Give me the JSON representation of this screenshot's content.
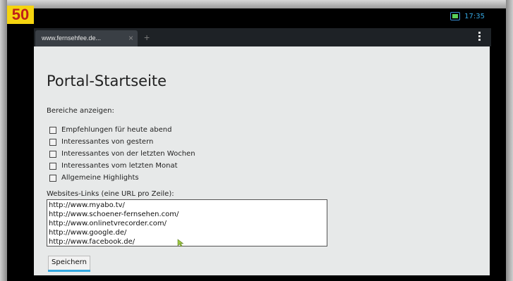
{
  "badge": {
    "number": "50"
  },
  "status_bar": {
    "time": "17:35",
    "icons": [
      "signal-icon"
    ]
  },
  "browser": {
    "tab_title": "www.fernsehfee.de...",
    "tab_close_glyph": "×",
    "new_tab_glyph": "+",
    "menu_icon": "overflow-menu-icon"
  },
  "page": {
    "title": "Portal-Startseite",
    "section_label": "Bereiche anzeigen:",
    "checkboxes": [
      {
        "label": "Empfehlungen für heute abend",
        "checked": false
      },
      {
        "label": "Interessantes von gestern",
        "checked": false
      },
      {
        "label": "Interessantes von der letzten Wochen",
        "checked": false
      },
      {
        "label": "Interessantes vom letzten Monat",
        "checked": false
      },
      {
        "label": "Allgemeine Highlights",
        "checked": false
      }
    ],
    "links_label": "Websites-Links (eine URL pro Zeile):",
    "links_value": "http://www.myabo.tv/\nhttp://www.schoener-fernsehen.com/\nhttp://www.onlinetvrecorder.com/\nhttp://www.google.de/\nhttp://www.facebook.de/",
    "save_label": "Speichern"
  },
  "colors": {
    "accent": "#33a8e0",
    "badge_bg": "#f5d40f",
    "badge_text": "#c0201a",
    "page_bg": "#e7e9e9"
  }
}
